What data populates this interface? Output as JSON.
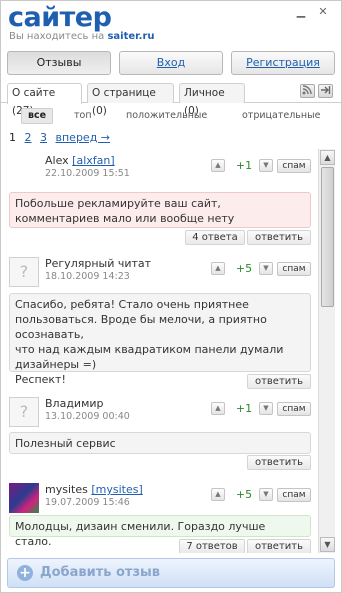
{
  "header": {
    "logo": "сайтер",
    "subtitle_prefix": "Вы находитесь на",
    "subtitle_site": "saiter.ru",
    "minimize_glyph": "▁",
    "close_glyph": "✕"
  },
  "nav": {
    "reviews": "Отзывы",
    "login": "Вход",
    "register": "Регистрация"
  },
  "tabs": [
    {
      "label": "О сайте (27)"
    },
    {
      "label": "О странице (0)"
    },
    {
      "label": "Личное (0)"
    }
  ],
  "tab_icons": {
    "rss": "rss-icon",
    "exit": "exit-icon"
  },
  "filters": [
    "все",
    "топ",
    "положительные",
    "отрицательные"
  ],
  "pager": {
    "current": "1",
    "p2": "2",
    "p3": "3",
    "next": "вперед →"
  },
  "posts": [
    {
      "author": "Alex",
      "nick": "[alxfan]",
      "date": "22.10.2009 15:51",
      "score": "+1",
      "spam": "спам",
      "text": "Побольше рекламируйте ваш сайт, комментариев мало или вообще нету",
      "replies": "4 ответа",
      "reply": "ответить"
    },
    {
      "author": "Регулярный читат",
      "nick": "",
      "date": "18.10.2009 14:23",
      "score": "+5",
      "spam": "спам",
      "text_lines": [
        "Спасибо, ребята! Стало очень приятнее",
        "пользоваться. Вроде бы мелочи, а приятно осознавать,",
        "что над каждым квадратиком панели думали",
        "дизайнеры =)",
        "Респект!"
      ],
      "reply": "ответить"
    },
    {
      "author": "Владимир",
      "nick": "",
      "date": "13.10.2009 00:40",
      "score": "+1",
      "spam": "спам",
      "text": "Полезный сервис",
      "reply": "ответить"
    },
    {
      "author": "mysites",
      "nick": "[mysites]",
      "date": "19.07.2009 15:46",
      "score": "+5",
      "spam": "спам",
      "text": "Молодцы, дизаин сменили. Гораздо лучше стало.",
      "replies": "7 ответов",
      "reply": "ответить"
    }
  ],
  "add_review": "Добавить отзыв",
  "colors": {
    "brand": "#1f5fb0",
    "positive": "#2a8a2a"
  }
}
